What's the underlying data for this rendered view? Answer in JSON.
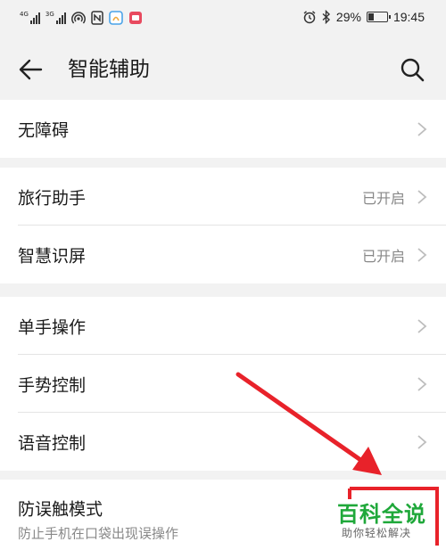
{
  "status_bar": {
    "signal1_gen": "4G",
    "signal2_gen": "3G",
    "battery": "29%",
    "battery_level": 0.29,
    "time": "19:45",
    "icons": [
      "signal-icon",
      "signal-icon",
      "hotspot-icon",
      "nfc-icon",
      "app-notification-icon",
      "app-notification-icon",
      "alarm-icon",
      "bluetooth-icon",
      "battery-icon"
    ]
  },
  "header": {
    "title": "智能辅助",
    "back_icon": "back-arrow-icon",
    "search_icon": "search-icon"
  },
  "groups": [
    {
      "items": [
        {
          "label": "无障碍",
          "value": ""
        }
      ]
    },
    {
      "items": [
        {
          "label": "旅行助手",
          "value": "已开启"
        },
        {
          "label": "智慧识屏",
          "value": "已开启"
        }
      ]
    },
    {
      "items": [
        {
          "label": "单手操作",
          "value": ""
        },
        {
          "label": "手势控制",
          "value": ""
        },
        {
          "label": "语音控制",
          "value": ""
        }
      ]
    },
    {
      "items": [
        {
          "label": "防误触模式",
          "sublabel": "防止手机在口袋出现误操作"
        }
      ]
    }
  ],
  "watermark": {
    "title": "百科全说",
    "subtitle": "助你轻松解决"
  },
  "colors": {
    "background": "#f2f2f2",
    "card": "#ffffff",
    "annotation": "#e8222a",
    "watermark_green": "#1fa83a"
  }
}
